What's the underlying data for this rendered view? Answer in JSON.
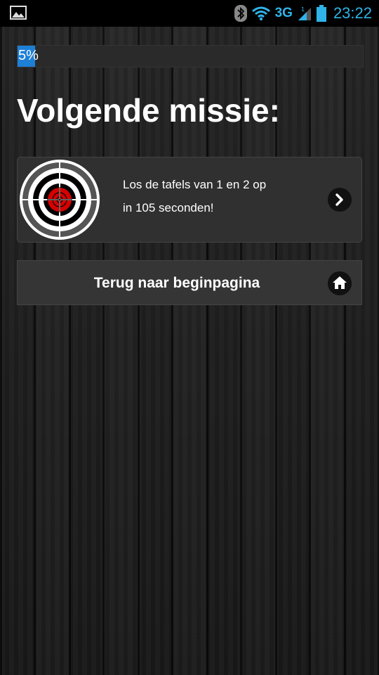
{
  "status_bar": {
    "time": "23:22",
    "network": "3G",
    "signal_badge": "1",
    "icons": [
      "gallery-icon",
      "bluetooth-icon",
      "wifi-icon",
      "signal-icon",
      "battery-icon"
    ],
    "accent_color": "#2fb3e8"
  },
  "progress": {
    "value_percent": 5,
    "label": "5%",
    "fill_color": "#1e7fd6"
  },
  "page": {
    "title": "Volgende missie:"
  },
  "mission": {
    "line1": "Los de tafels van 1 en 2 op",
    "line2": "in 105 seconden!",
    "icon": "target-icon",
    "action_icon": "chevron-right-icon"
  },
  "home": {
    "label": "Terug naar beginpagina",
    "icon": "home-icon"
  }
}
